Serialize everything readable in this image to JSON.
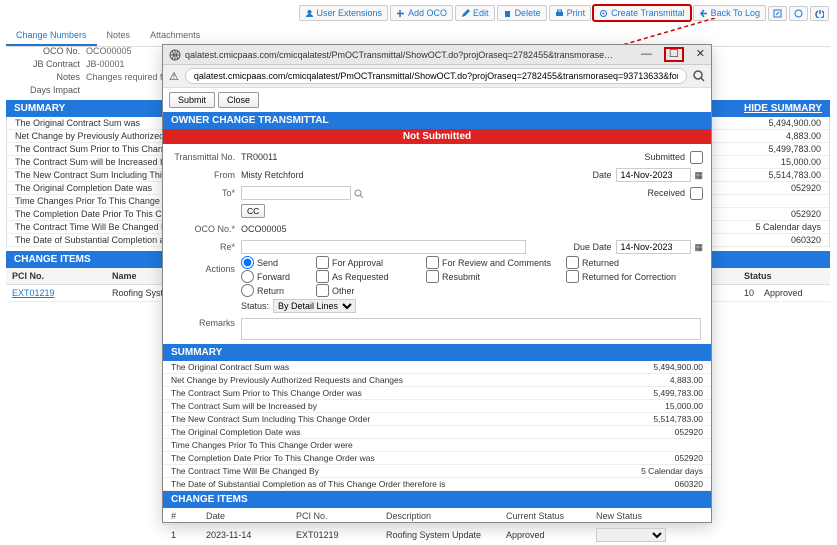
{
  "toolbar": {
    "user_extensions": "User Extensions",
    "add_oco": "Add OCO",
    "edit": "Edit",
    "delete": "Delete",
    "print": "Print",
    "create_transmittal": "Create Transmittal",
    "back_to_log": "Back To Log"
  },
  "tabs": {
    "change_numbers": "Change Numbers",
    "notes": "Notes",
    "attachments": "Attachments"
  },
  "bg_form": {
    "oco_no_lbl": "OCO No.",
    "oco_no_val": "OCO00005",
    "jb_lbl": "JB Contract",
    "jb_val": "JB-00001",
    "notes_lbl": "Notes",
    "notes_val": "Changes required for roofing",
    "days_lbl": "Days Impact"
  },
  "bg_sections": {
    "summary": "SUMMARY",
    "hide_summary": "HIDE SUMMARY",
    "change_items": "CHANGE ITEMS",
    "pci_no": "PCI No.",
    "name": "Name",
    "status": "Status",
    "item_pci": "EXT01219",
    "item_name": "Roofing System Up",
    "item_count": "10",
    "item_status": "Approved"
  },
  "bg_summary": {
    "r1l": "The Original Contract Sum was",
    "r1v": "5,494,900.00",
    "r2l": "Net Change by Previously Authorized Requests and C",
    "r2v": "4,883.00",
    "r3l": "The Contract Sum Prior to This Change Order was",
    "r3v": "5,499,783.00",
    "r4l": "The Contract Sum will be Increased by",
    "r4v": "15,000.00",
    "r5l": "The New Contract Sum Including This Change Order",
    "r5v": "5,514,783.00",
    "r6l": "The Original Completion Date was",
    "r6v": "052920",
    "r7l": "Time Changes Prior To This Change Order were",
    "r8l": "The Completion Date Prior To This Change Order was",
    "r8v": "052920",
    "r9l": "The Contract Time Will Be Changed By",
    "r9v": "5 Calendar days",
    "r10l": "The Date of Substantial Completion as of This Change",
    "r10v": "060320"
  },
  "popup": {
    "title_url": "qalatest.cmicpaas.com/cmicqalatest/PmOCTransmittal/ShowOCT.do?projOraseq=2782455&transmoraseq=93713633&forwarded=t...",
    "addr_url": "qalatest.cmicpaas.com/cmicqalatest/PmOCTransmittal/ShowOCT.do?projOraseq=2782455&transmoraseq=93713633&forwar...",
    "submit": "Submit",
    "close": "Close",
    "header": "OWNER CHANGE TRANSMITTAL",
    "not_submitted": "Not Submitted",
    "transmittal_no_lbl": "Transmittal No.",
    "transmittal_no_val": "TR00011",
    "submitted_lbl": "Submitted",
    "from_lbl": "From",
    "from_val": "Misty Retchford",
    "date_lbl": "Date",
    "date_val": "14-Nov-2023",
    "to_lbl": "To*",
    "received_lbl": "Received",
    "cc_lbl": "CC",
    "oco_lbl": "OCO No.*",
    "oco_val": "OCO00005",
    "re_lbl": "Re*",
    "due_date_lbl": "Due Date",
    "due_date_val": "14-Nov-2023",
    "actions_lbl": "Actions",
    "send": "Send",
    "forward": "Forward",
    "return": "Return",
    "for_approval": "For Approval",
    "as_requested": "As Requested",
    "for_review": "For Review and Comments",
    "resubmit": "Resubmit",
    "returned": "Returned",
    "returned_correction": "Returned for Correction",
    "other": "Other",
    "status_lbl": "Status:",
    "status_val": "By Detail Lines",
    "remarks_lbl": "Remarks",
    "summary_hdr": "SUMMARY",
    "change_items_hdr": "CHANGE ITEMS"
  },
  "popup_summary": {
    "r1l": "The Original Contract Sum was",
    "r1v": "5,494,900.00",
    "r2l": "Net Change by Previously Authorized Requests and Changes",
    "r2v": "4,883.00",
    "r3l": "The Contract Sum Prior to This Change Order was",
    "r3v": "5,499,783.00",
    "r4l": "The Contract Sum will be Increased by",
    "r4v": "15,000.00",
    "r5l": "The New Contract Sum Including This Change Order",
    "r5v": "5,514,783.00",
    "r6l": "The Original Completion Date was",
    "r6v": "052920",
    "r7l": "Time Changes Prior To This Change Order were",
    "r8l": "The Completion Date Prior To This Change Order was",
    "r8v": "052920",
    "r9l": "The Contract Time Will Be Changed By",
    "r9v": "5 Calendar days",
    "r10l": "The Date of Substantial Completion as of This Change Order therefore is",
    "r10v": "060320"
  },
  "popup_table": {
    "h_num": "#",
    "h_date": "Date",
    "h_pci": "PCI No.",
    "h_desc": "Description",
    "h_curr": "Current Status",
    "h_new": "New Status",
    "r_num": "1",
    "r_date": "2023-11-14",
    "r_pci": "EXT01219",
    "r_desc": "Roofing System Update",
    "r_curr": "Approved"
  }
}
